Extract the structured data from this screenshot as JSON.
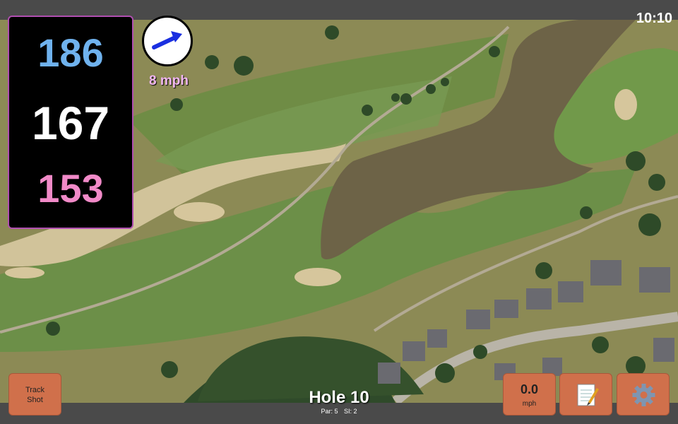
{
  "status": {
    "time": "10:10"
  },
  "yardage": {
    "back": "186",
    "center": "167",
    "front": "153"
  },
  "wind": {
    "speed_text": "8 mph",
    "direction": "east-northeast"
  },
  "buttons": {
    "track_shot_line1": "Track",
    "track_shot_line2": "Shot",
    "wind_value": "0.0",
    "wind_unit": "mph",
    "notes_icon": "notepad-icon",
    "settings_icon": "gear-icon"
  },
  "hole": {
    "title": "Hole 10",
    "par": "Par: 5",
    "si": "SI: 2"
  },
  "colors": {
    "back": "#6fb2ee",
    "center": "#ffffff",
    "front": "#f18ac8",
    "accent": "#d0704b",
    "panel_border": "#b04fb0"
  }
}
